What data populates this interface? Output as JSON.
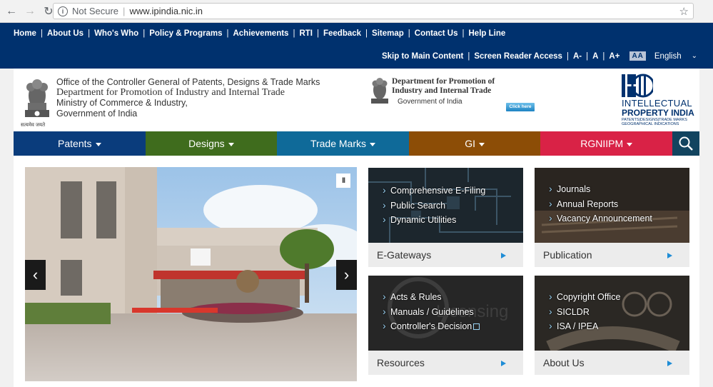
{
  "browser": {
    "security": "Not Secure",
    "url": "www.ipindia.nic.in"
  },
  "topnav": {
    "links": [
      "Home",
      "About Us",
      "Who's Who",
      "Policy & Programs",
      "Achievements",
      "RTI",
      "Feedback",
      "Sitemap",
      "Contact Us",
      "Help Line"
    ]
  },
  "accessibility": {
    "skip": "Skip to Main Content",
    "screen_reader": "Screen Reader Access",
    "font_minus": "A-",
    "font_normal": "A",
    "font_plus": "A+",
    "contrast": "AA",
    "language": "English"
  },
  "header": {
    "emblem_text": "सत्यमेव जयते",
    "line1": "Office of the Controller General of Patents, Designs & Trade Marks",
    "line2": "Department for Promotion of Industry and Internal Trade",
    "line3": "Ministry of Commerce & Industry,",
    "line4": "Government of India",
    "dept_line1": "Department for Promotion of",
    "dept_line2": "Industry and Internal Trade",
    "dept_gov": "Government of India",
    "click_here": "Click here",
    "ipi_line1": "INTELLECTUAL",
    "ipi_line2": "PROPERTY INDIA",
    "ipi_line3": "PATENTS|DESIGNS|TRADE MARKS GEOGRAPHICAL INDICATIONS"
  },
  "menu": {
    "items": [
      {
        "label": "Patents",
        "color": "#0a3c7c"
      },
      {
        "label": "Designs",
        "color": "#3f6c1d"
      },
      {
        "label": "Trade Marks",
        "color": "#0f6a99"
      },
      {
        "label": "GI",
        "color": "#8c4d06"
      },
      {
        "label": "RGNIIPM",
        "color": "#d92246"
      }
    ]
  },
  "tiles": {
    "egateways": {
      "title": "E-Gateways",
      "items": [
        "Comprehensive E-Filing",
        "Public Search",
        "Dynamic Utilities"
      ]
    },
    "publication": {
      "title": "Publication",
      "items": [
        "Journals",
        "Annual Reports",
        "Vacancy Announcement"
      ]
    },
    "resources": {
      "title": "Resources",
      "items": [
        "Acts & Rules",
        "Manuals / Guidelines",
        "Controller's Decision"
      ],
      "bg_word": "Licensing"
    },
    "about": {
      "title": "About Us",
      "items": [
        "Copyright Office",
        "SICLDR",
        "ISA / IPEA"
      ]
    }
  }
}
